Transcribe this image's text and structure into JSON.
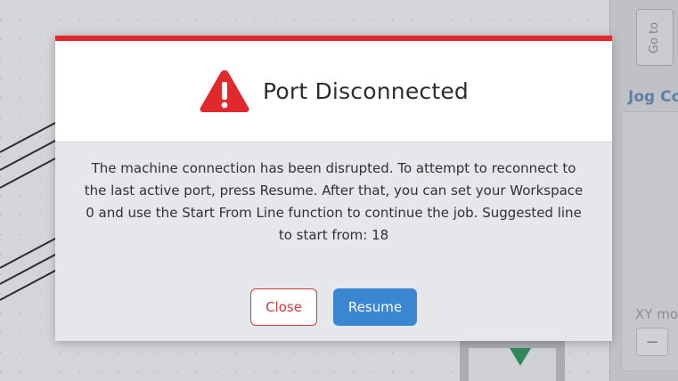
{
  "modal": {
    "title": "Port Disconnected",
    "message": "The machine connection has been disrupted. To attempt to reconnect to the last active port, press Resume. After that, you can set your Workspace 0 and use the Start From Line function to continue the job. Suggested line to start from: 18",
    "close_label": "Close",
    "resume_label": "Resume",
    "icon": "warning-triangle-icon",
    "accent_color": "#e1282d",
    "resume_color": "#3b86d0"
  },
  "background": {
    "goto_label": "Go to",
    "jog_title": "Jog Co",
    "xy_label": "XY mo",
    "xy_minus": "−"
  }
}
